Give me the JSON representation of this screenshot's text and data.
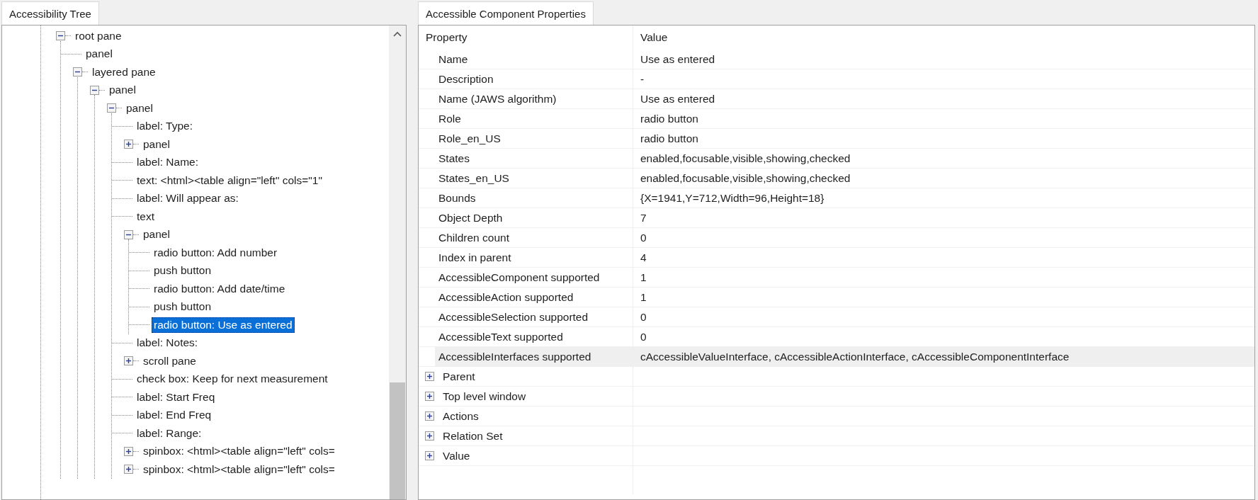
{
  "tree_panel": {
    "tab": {
      "label": "Accessibility Tree",
      "selected": true
    },
    "tree": [
      {
        "label": "root pane",
        "expanded": true,
        "selected": false,
        "children": [
          {
            "label": "panel",
            "selected": false
          },
          {
            "label": "layered pane",
            "expanded": true,
            "selected": false,
            "children": [
              {
                "label": "panel",
                "expanded": true,
                "selected": false,
                "children": [
                  {
                    "label": "panel",
                    "expanded": true,
                    "selected": false,
                    "children": [
                      {
                        "label": "label: Type:",
                        "selected": false
                      },
                      {
                        "label": "panel",
                        "expanded": false,
                        "selected": false
                      },
                      {
                        "label": "label: Name:",
                        "selected": false
                      },
                      {
                        "label": "text: <html><table align=\"left\" cols=\"1\"",
                        "selected": false
                      },
                      {
                        "label": "label: Will appear as:",
                        "selected": false
                      },
                      {
                        "label": "text",
                        "selected": false
                      },
                      {
                        "label": "panel",
                        "expanded": true,
                        "selected": false,
                        "children": [
                          {
                            "label": "radio button: Add number",
                            "selected": false
                          },
                          {
                            "label": "push button",
                            "selected": false
                          },
                          {
                            "label": "radio button: Add date/time",
                            "selected": false
                          },
                          {
                            "label": "push button",
                            "selected": false
                          },
                          {
                            "label": "radio button: Use as entered",
                            "selected": true
                          }
                        ]
                      },
                      {
                        "label": "label: Notes:",
                        "selected": false
                      },
                      {
                        "label": "scroll pane",
                        "expanded": false,
                        "selected": false
                      },
                      {
                        "label": "check box: Keep for next measurement",
                        "selected": false
                      },
                      {
                        "label": "label: Start Freq",
                        "selected": false
                      },
                      {
                        "label": "label: End Freq",
                        "selected": false
                      },
                      {
                        "label": "label: Range:",
                        "selected": false
                      },
                      {
                        "label": "spinbox: <html><table align=\"left\" cols=",
                        "expanded": false,
                        "selected": false
                      },
                      {
                        "label": "spinbox: <html><table align=\"left\" cols=",
                        "expanded": false,
                        "selected": false
                      }
                    ]
                  }
                ]
              }
            ]
          }
        ]
      }
    ]
  },
  "properties_panel": {
    "tab": {
      "label": "Accessible Component Properties",
      "selected": true
    },
    "table": {
      "columns": [
        "Property",
        "Value"
      ],
      "rows": [
        {
          "kind": "prop",
          "property": "Name",
          "value": "Use as entered",
          "selected": false
        },
        {
          "kind": "prop",
          "property": "Description",
          "value": "-",
          "selected": false
        },
        {
          "kind": "prop",
          "property": "Name (JAWS algorithm)",
          "value": "Use as entered",
          "selected": false
        },
        {
          "kind": "prop",
          "property": "Role",
          "value": "radio button",
          "selected": false
        },
        {
          "kind": "prop",
          "property": "Role_en_US",
          "value": "radio button",
          "selected": false
        },
        {
          "kind": "prop",
          "property": "States",
          "value": "enabled,focusable,visible,showing,checked",
          "selected": false
        },
        {
          "kind": "prop",
          "property": "States_en_US",
          "value": "enabled,focusable,visible,showing,checked",
          "selected": false
        },
        {
          "kind": "prop",
          "property": "Bounds",
          "value": "{X=1941,Y=712,Width=96,Height=18}",
          "selected": false
        },
        {
          "kind": "prop",
          "property": "Object Depth",
          "value": "7",
          "selected": false
        },
        {
          "kind": "prop",
          "property": "Children count",
          "value": "0",
          "selected": false
        },
        {
          "kind": "prop",
          "property": "Index in parent",
          "value": "4",
          "selected": false
        },
        {
          "kind": "prop",
          "property": "AccessibleComponent supported",
          "value": "1",
          "selected": false
        },
        {
          "kind": "prop",
          "property": "AccessibleAction supported",
          "value": "1",
          "selected": false
        },
        {
          "kind": "prop",
          "property": "AccessibleSelection supported",
          "value": "0",
          "selected": false
        },
        {
          "kind": "prop",
          "property": "AccessibleText supported",
          "value": "0",
          "selected": false
        },
        {
          "kind": "prop",
          "property": "AccessibleInterfaces supported",
          "value": "cAccessibleValueInterface, cAccessibleActionInterface, cAccessibleComponentInterface",
          "selected": true
        },
        {
          "kind": "group",
          "property": "Parent",
          "expanded": false
        },
        {
          "kind": "group",
          "property": "Top level window",
          "expanded": false
        },
        {
          "kind": "group",
          "property": "Actions",
          "expanded": false
        },
        {
          "kind": "group",
          "property": "Relation Set",
          "expanded": false
        },
        {
          "kind": "group",
          "property": "Value",
          "expanded": false
        }
      ]
    }
  }
}
